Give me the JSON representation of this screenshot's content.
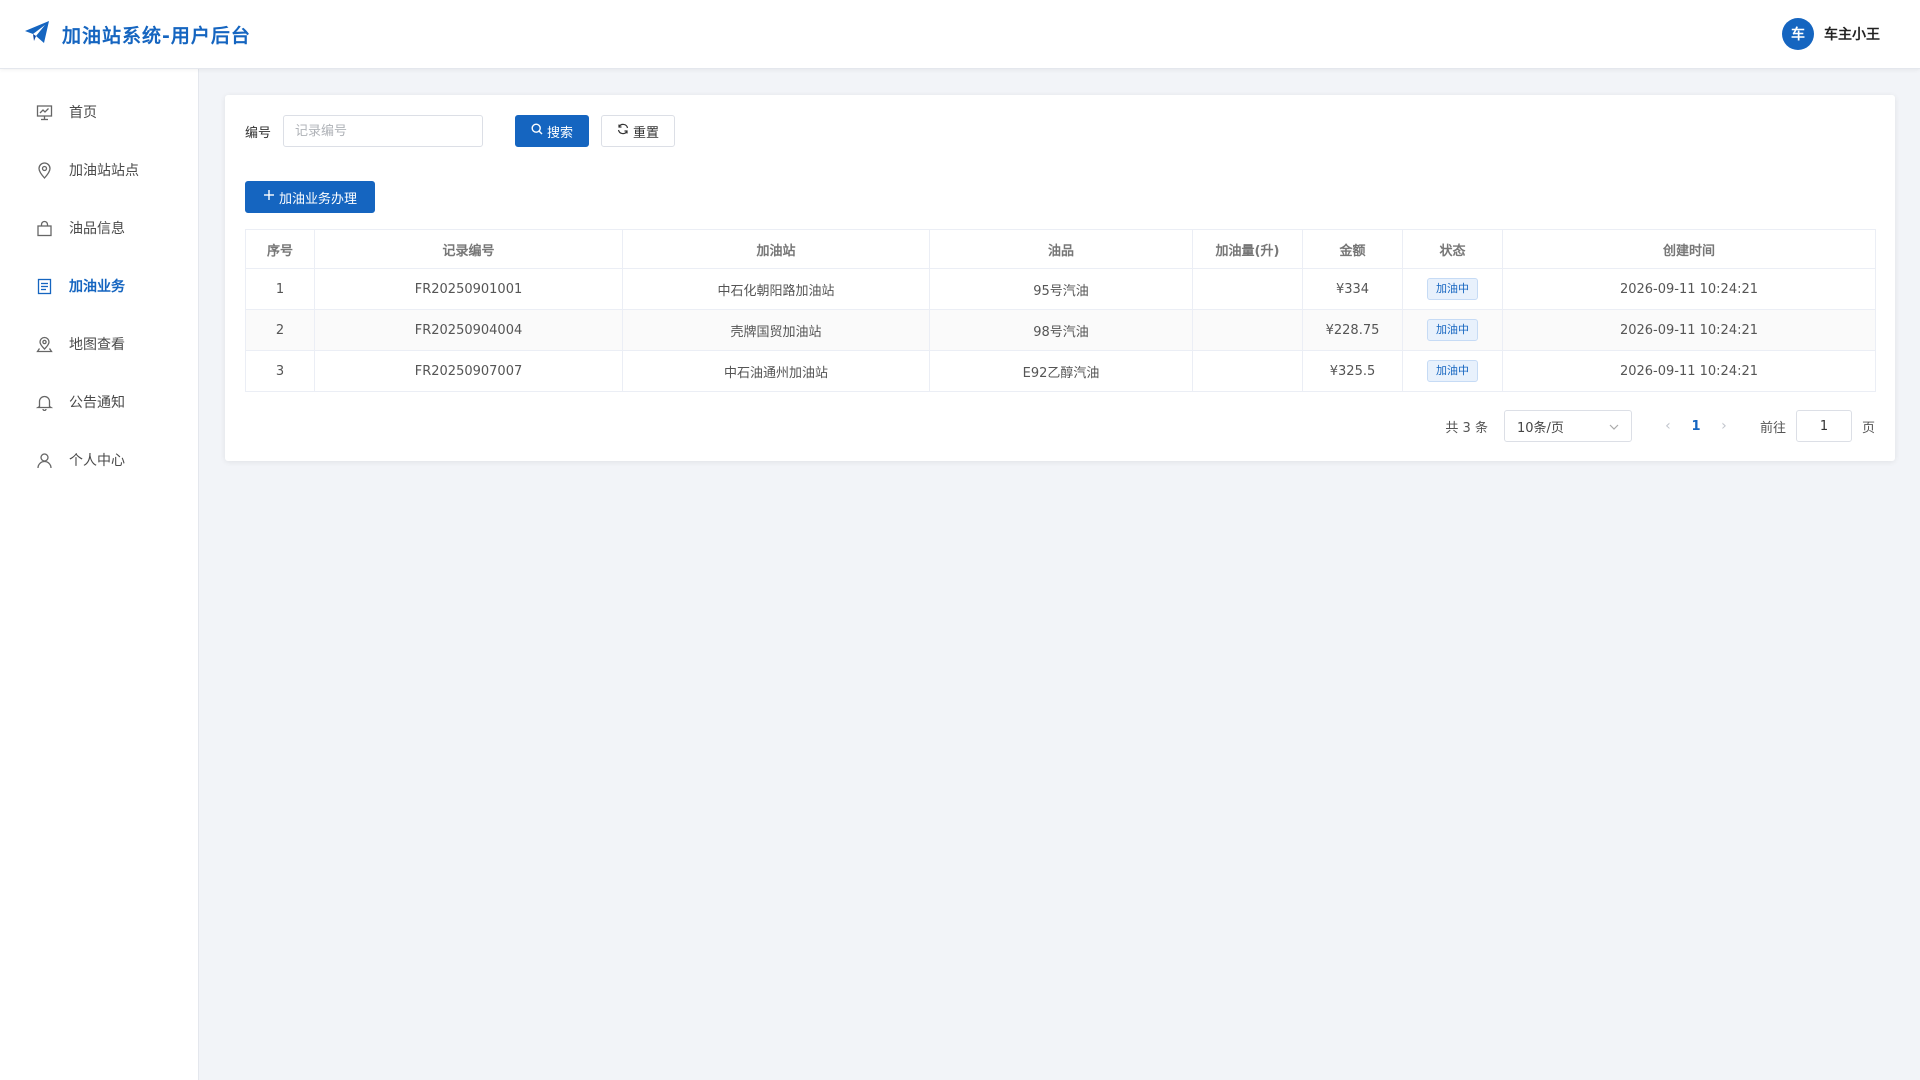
{
  "header": {
    "title": "加油站系统-用户后台",
    "logo_icon": "paper-plane-icon",
    "user": {
      "avatar_text": "车",
      "name": "车主小王"
    }
  },
  "colors": {
    "primary": "#1565c0",
    "background": "#f2f4f8"
  },
  "sidebar": {
    "items": [
      {
        "label": "首页",
        "icon": "dashboard-icon",
        "active": false
      },
      {
        "label": "加油站站点",
        "icon": "location-pin-icon",
        "active": false
      },
      {
        "label": "油品信息",
        "icon": "shopping-bag-icon",
        "active": false
      },
      {
        "label": "加油业务",
        "icon": "document-icon",
        "active": true
      },
      {
        "label": "地图查看",
        "icon": "map-marker-icon",
        "active": false
      },
      {
        "label": "公告通知",
        "icon": "bell-icon",
        "active": false
      },
      {
        "label": "个人中心",
        "icon": "user-icon",
        "active": false
      }
    ]
  },
  "search": {
    "label": "编号",
    "placeholder": "记录编号",
    "value": "",
    "search_button": "搜索",
    "reset_button": "重置"
  },
  "toolbar": {
    "add_button": "加油业务办理"
  },
  "table": {
    "columns": [
      "序号",
      "记录编号",
      "加油站",
      "油品",
      "加油量(升)",
      "金额",
      "状态",
      "创建时间"
    ],
    "rows": [
      {
        "index": "1",
        "record_no": "FR20250901001",
        "station": "中石化朝阳路加油站",
        "fuel": "95号汽油",
        "volume": "",
        "amount": "¥334",
        "status": "加油中",
        "created_at": "2026-09-11 10:24:21"
      },
      {
        "index": "2",
        "record_no": "FR20250904004",
        "station": "壳牌国贸加油站",
        "fuel": "98号汽油",
        "volume": "",
        "amount": "¥228.75",
        "status": "加油中",
        "created_at": "2026-09-11 10:24:21"
      },
      {
        "index": "3",
        "record_no": "FR20250907007",
        "station": "中石油通州加油站",
        "fuel": "E92乙醇汽油",
        "volume": "",
        "amount": "¥325.5",
        "status": "加油中",
        "created_at": "2026-09-11 10:24:21"
      }
    ]
  },
  "pagination": {
    "total_text": "共 3 条",
    "page_size": "10条/页",
    "current_page": "1",
    "goto_label": "前往",
    "goto_value": "1",
    "page_suffix": "页"
  }
}
